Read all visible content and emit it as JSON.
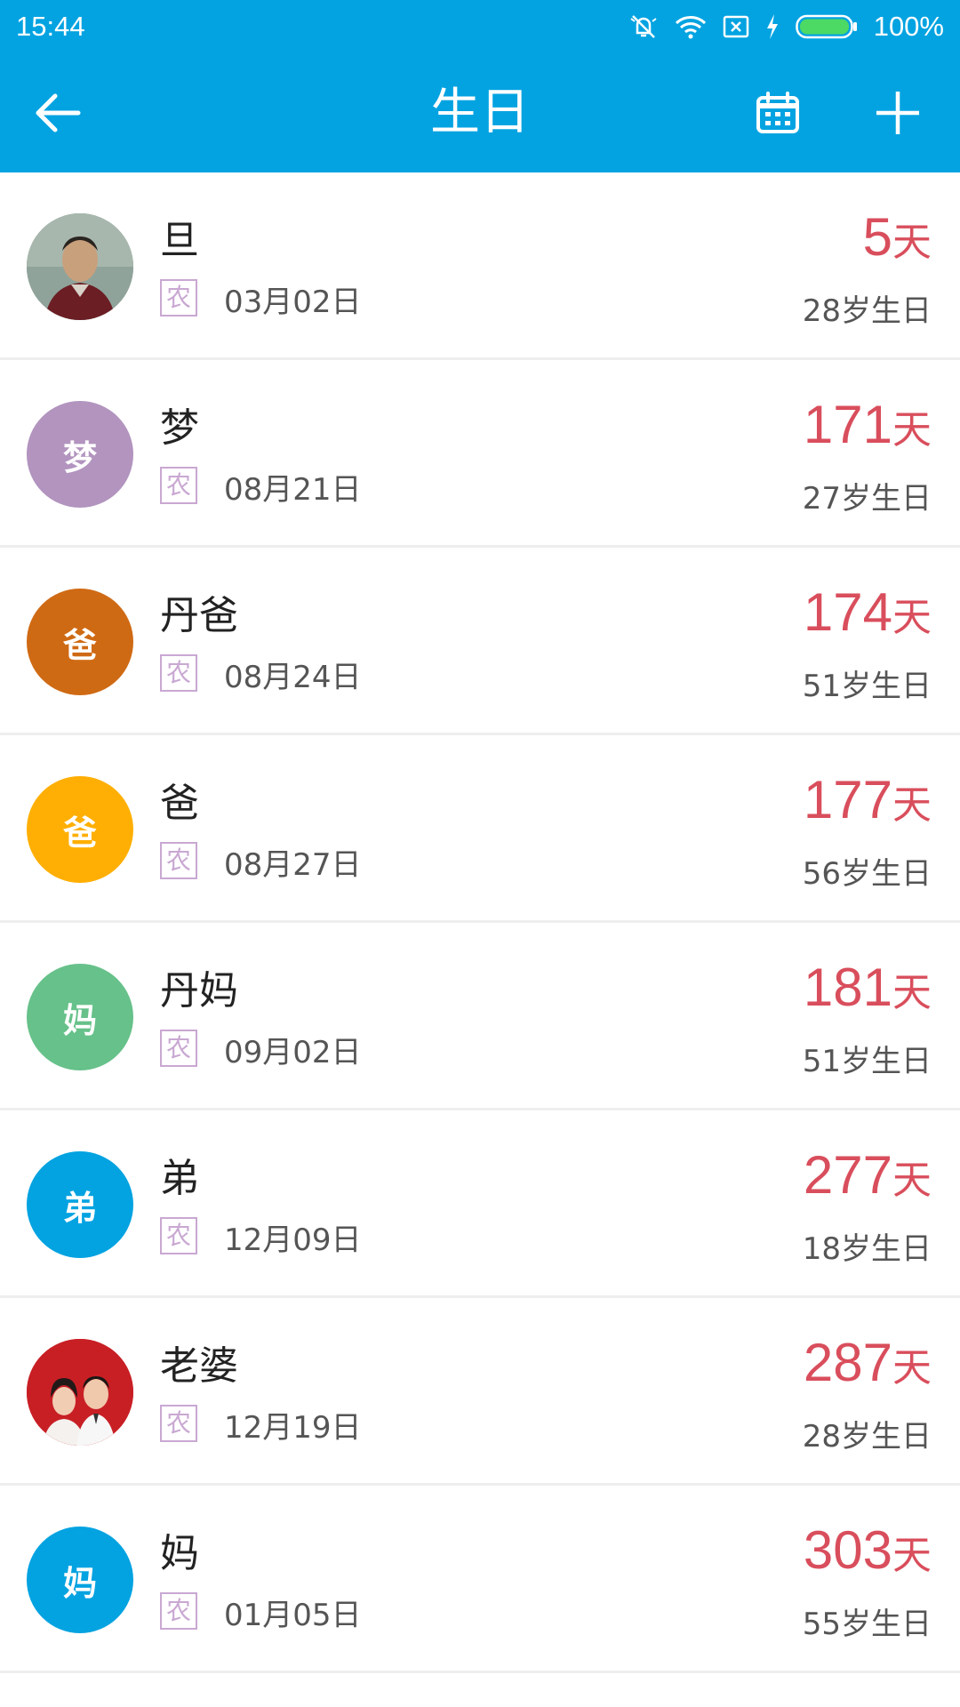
{
  "status_bar": {
    "time": "15:44",
    "battery": "100%",
    "icons": [
      "mute-icon",
      "wifi-icon",
      "no-sim-icon",
      "charging-icon",
      "battery-icon"
    ]
  },
  "header": {
    "title": "生日",
    "icons": [
      "back-arrow-icon",
      "calendar-icon",
      "plus-icon"
    ]
  },
  "colors": {
    "primary": "#03a3e1",
    "days_red": "#d94e5c",
    "lunar_badge": "#c9a8d2"
  },
  "birthdays": [
    {
      "name": "旦",
      "avatar_type": "photo-man",
      "avatar_letter": "",
      "avatar_color": "#7a8a80",
      "lunar": "农",
      "date": "03月02日",
      "days": "5",
      "days_unit": "天",
      "age": "28岁生日"
    },
    {
      "name": "梦",
      "avatar_type": "letter",
      "avatar_letter": "梦",
      "avatar_color": "#b294bf",
      "lunar": "农",
      "date": "08月21日",
      "days": "171",
      "days_unit": "天",
      "age": "27岁生日"
    },
    {
      "name": "丹爸",
      "avatar_type": "letter",
      "avatar_letter": "爸",
      "avatar_color": "#cf6a14",
      "lunar": "农",
      "date": "08月24日",
      "days": "174",
      "days_unit": "天",
      "age": "51岁生日"
    },
    {
      "name": "爸",
      "avatar_type": "letter",
      "avatar_letter": "爸",
      "avatar_color": "#ffaf03",
      "lunar": "农",
      "date": "08月27日",
      "days": "177",
      "days_unit": "天",
      "age": "56岁生日"
    },
    {
      "name": "丹妈",
      "avatar_type": "letter",
      "avatar_letter": "妈",
      "avatar_color": "#67c18a",
      "lunar": "农",
      "date": "09月02日",
      "days": "181",
      "days_unit": "天",
      "age": "51岁生日"
    },
    {
      "name": "弟",
      "avatar_type": "letter",
      "avatar_letter": "弟",
      "avatar_color": "#03a3e1",
      "lunar": "农",
      "date": "12月09日",
      "days": "277",
      "days_unit": "天",
      "age": "18岁生日"
    },
    {
      "name": "老婆",
      "avatar_type": "photo-couple",
      "avatar_letter": "",
      "avatar_color": "#c81f25",
      "lunar": "农",
      "date": "12月19日",
      "days": "287",
      "days_unit": "天",
      "age": "28岁生日"
    },
    {
      "name": "妈",
      "avatar_type": "letter",
      "avatar_letter": "妈",
      "avatar_color": "#03a3e1",
      "lunar": "农",
      "date": "01月05日",
      "days": "303",
      "days_unit": "天",
      "age": "55岁生日"
    }
  ]
}
